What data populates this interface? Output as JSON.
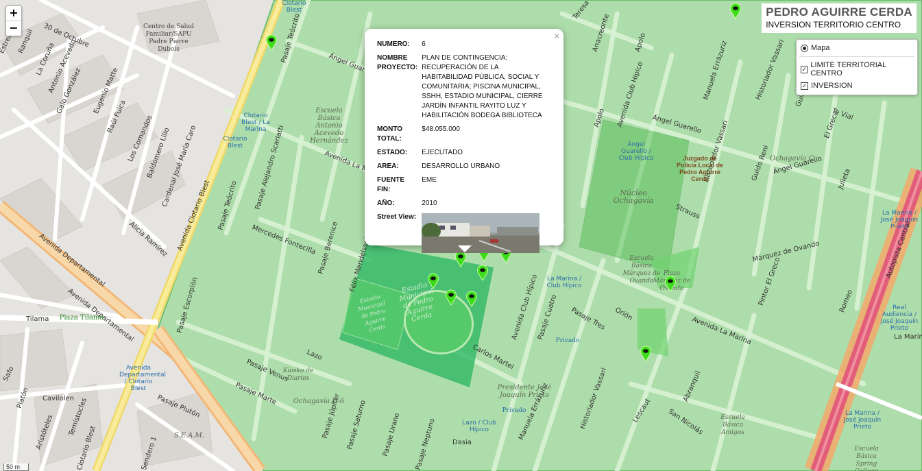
{
  "title": {
    "main": "PEDRO AGUIRRE CERDA",
    "sub": "INVERSION TERRITORIO CENTRO"
  },
  "zoom": {
    "in": "+",
    "out": "−"
  },
  "layers": {
    "base": "Mapa",
    "overlays": [
      "LIMITE TERRITORIAL CENTRO",
      "INVERSION"
    ]
  },
  "popup": {
    "close": "×",
    "fields": [
      {
        "k": "NUMERO:",
        "v": "6"
      },
      {
        "k": "NOMBRE PROYECTO:",
        "v": "PLAN DE CONTINGENCIA: RECUPERACIÓN DE LA HABITABILIDAD PÚBLICA, SOCIAL Y COMUNITARIA; PISCINA MUNICIPAL, SSHH, ESTADIO MUNICIPAL, CIERRE JARDÍN INFANTIL RAYITO LUZ Y HABILITACIÓN BODEGA BIBLIOTECA"
      },
      {
        "k": "MONTO TOTAL:",
        "v": "$48.055.000"
      },
      {
        "k": "ESTADO:",
        "v": "EJECUTADO"
      },
      {
        "k": "AREA:",
        "v": "DESARROLLO URBANO"
      },
      {
        "k": "FUENTE FIN:",
        "v": "EME"
      },
      {
        "k": "AÑO:",
        "v": "2010"
      }
    ],
    "street_view_label": "Street View:"
  },
  "scale": "50 m",
  "streets": {
    "octubre": "30 de Octubre",
    "estrella": "Estrella",
    "ranquil": "Ranquil",
    "coruna": "La Coruña",
    "antonio_acevedo": "Antonio Acevedo",
    "galo": "Galo González",
    "eugenio": "Eugenio Matte",
    "raul": "Raúl Fuica",
    "comandos": "Los Comandos",
    "baldomero": "Baldomero Lillo",
    "cardenal": "Cardenal José María Caro",
    "alicia": "Alicia Ramírez",
    "av_dep1": "Avenida Departamental",
    "av_dep2": "Avenida Departamental",
    "tilama": "Tilama",
    "safo": "Safo",
    "platon": "Platón",
    "cavilolen": "Cavilolen",
    "aristoteles": "Aristóteles",
    "temistocles": "Temístocles",
    "pasaje_pluton": "Pasaje Plutón",
    "clotario1": "Avenida Clotario Blest",
    "clotario2": "Clotario Blest",
    "sendero": "Sendero 1",
    "teocrito": "Pasaje Teócrito",
    "pasaje_teocrito2": "Pasaje Teócrito",
    "angel1": "Ángel Guarello",
    "angel2": "Ángel Guarello",
    "angel3": "Ángel Guarello",
    "av_lamarina_left": "Avenida La Marina",
    "av_lamarina_right": "Avenida La Marina",
    "scarlatti": "Pasaje Alejandro Scarlatti",
    "mercedes": "Mercedes Fontecilla",
    "berenice": "Pasaje Berenice",
    "felix": "Félix Mendelssohn",
    "escorpion": "Pasaje Escorpión",
    "venus": "Pasaje Venus",
    "marte": "Pasaje Marte",
    "lazo": "Lazo",
    "jupiter": "Pasaje Júpiter",
    "saturno": "Pasaje Saturno",
    "urano": "Pasaje Urano",
    "neptuno": "Pasaje Neptuno",
    "carlos_martel": "Carlos Martel",
    "club_hipico": "Avenida Club Hípico",
    "club_hipico2": "Avenida Club Hípico",
    "cuatro": "Pasaje Cuatro",
    "tres": "Pasaje Tres",
    "orion": "Orión",
    "teresa": "Teresa Vial",
    "anacreonte": "Anacreonte",
    "apolo": "Apolo",
    "apolo2": "Apolo",
    "manuela": "Manuela Errázuriz",
    "historiador": "Historiador Vassari",
    "historiador2": "Historiador Vassari",
    "historiador3": "Historiador Vassari",
    "guido": "Guido Reni",
    "guido2": "Guido Reni",
    "tevial": "Te Vial",
    "elgreco": "El Greco",
    "strauss": "Strauss",
    "marquez": "Márquez de Ovando",
    "pintor": "Pintor El Greco",
    "romeo": "Romeo",
    "lescaut": "Lescaut",
    "sannicolas": "San Nicolás",
    "abranquil": "Abranquil",
    "autopista": "Autopista Central",
    "lamarina_right": "La Marina",
    "manuela2": "Manuela Errázuriz",
    "dasia": "Dasia",
    "julieta": "Julieta"
  },
  "places": {
    "estadio": "Estadio Municipal de Pedro Aguirre Cerda",
    "estadio2": "Estadio Municipal de Pedro Aguirre Cerda",
    "escuela_antonio": "Escuela Básica Antonio Acevedo Hernández",
    "nucleo": "Núcleo Ochagavía",
    "juzgado": "Juzgado de Policía Local de Pedro Aguirre Cerda",
    "ochagavia_c": "Ochagavía C",
    "escuela_marquez": "Escuela Básica Márquez de Ovando",
    "plaza_marquez": "Plaza Márquez de Ovando",
    "presidente": "Presidente José Joaquín Prieto",
    "ochagavia_d6": "Ochagavía D-6",
    "kiosko": "Kiosko de Diarios",
    "seam": "S.E.A.M.",
    "plaza_tilama": "Plaza Tilama",
    "escuela_amigos": "Escuela Básica Amigos",
    "escuela_spring": "Escuela Básica Spring College Escuela",
    "centro_salud": "Centro de Salud Familiar/SAPU Padre Pierre Dubois",
    "privado1": "Privado",
    "privado2": "Privado"
  },
  "pois": {
    "clotario_a": "Clotario Blest / La Marina",
    "clotario_b": "Clotario Blest",
    "angel_hipico": "Ángel Guarello / Club Hípico",
    "marina_hipico": "La Marina / Club Hípico",
    "lazo_hipico": "Lazo / Club Hípico",
    "av_dep_clotario": "Avenida Departamental / Clotario Blest",
    "real_audiencia": "Real Audiencia / José Joaquín Prieto",
    "la_marina_jjp": "La Marina / José Joaquín Prieto",
    "jjp_right": "La Marina / José Joaquín Prieto",
    "clotario_top": "Clotario Blest"
  },
  "colors": {
    "territory": "#4fd64f",
    "stadium": "#33b86a",
    "marker": "#3ddc1a",
    "avenue": "#f5c98c",
    "highway": "#e87b8f"
  },
  "markers_count": 13
}
